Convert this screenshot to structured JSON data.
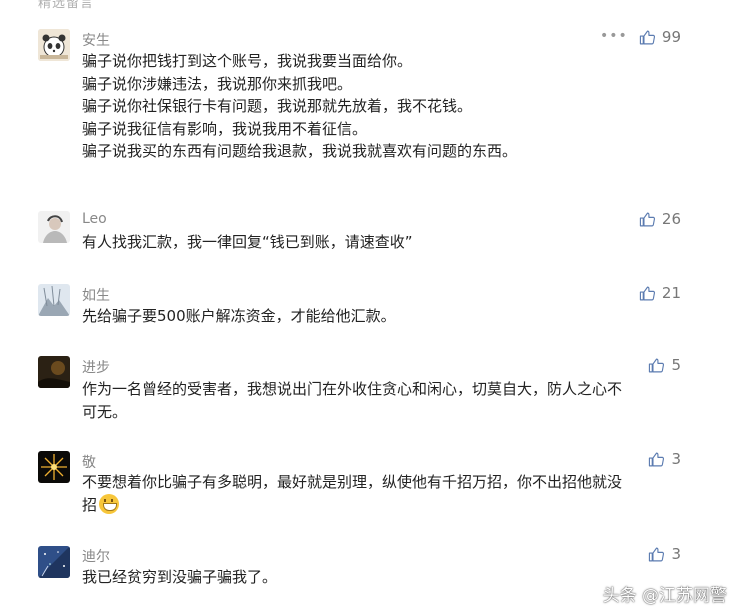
{
  "top_partial_text": "精选留言",
  "comments": [
    {
      "name": "安生",
      "likes": "99",
      "lines": [
        "骗子说你把钱打到这个账号，我说我要当面给你。",
        "骗子说你涉嫌违法，我说那你来抓我吧。",
        "骗子说你社保银行卡有问题，我说那就先放着，我不花钱。",
        "骗子说我征信有影响，我说我用不着征信。",
        "骗子说我买的东西有问题给我退款，我说我就喜欢有问题的东西。"
      ]
    },
    {
      "name": "Leo",
      "likes": "26",
      "lines": [
        "有人找我汇款，我一律回复“钱已到账，请速查收”"
      ]
    },
    {
      "name": "如生",
      "likes": "21",
      "lines": [
        "先给骗子要500账户解冻资金，才能给他汇款。"
      ]
    },
    {
      "name": "进步",
      "likes": "5",
      "lines": [
        "作为一名曾经的受害者，我想说出门在外收住贪心和闲心，切莫自大，防人之心不",
        "可无。"
      ]
    },
    {
      "name": "敬",
      "likes": "3",
      "lines": [
        "不要想着你比骗子有多聪明，最好就是别理，纵使他有千招万招，你不出招他就没",
        "招"
      ]
    },
    {
      "name": "迪尔",
      "likes": "3",
      "lines": [
        "我已经贫穷到没骗子骗我了。"
      ]
    }
  ],
  "more_glyph": "•••",
  "watermark": "头条 @江苏网警"
}
